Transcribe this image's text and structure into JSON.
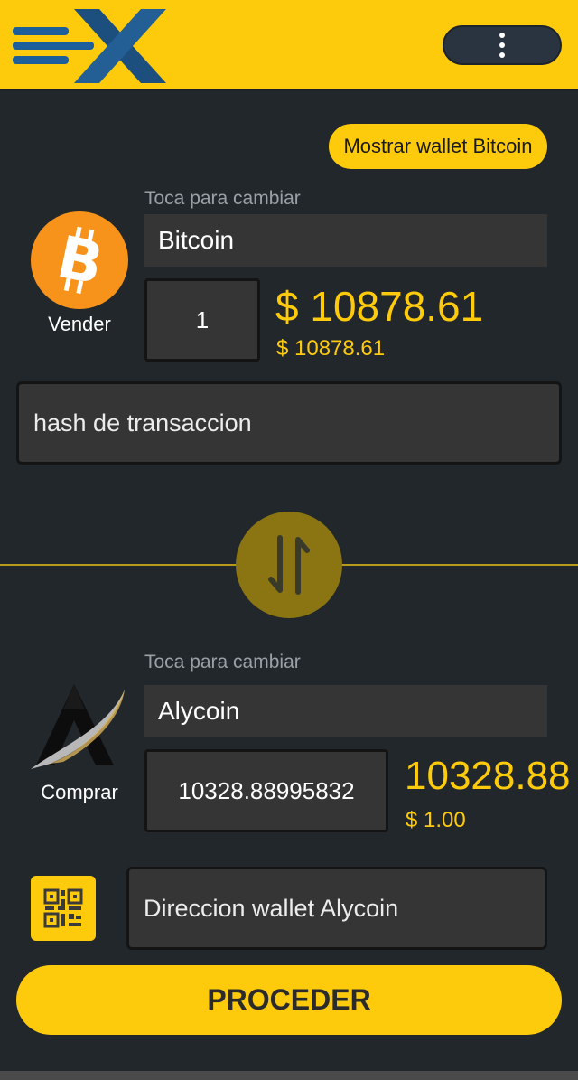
{
  "header": {
    "logo_icon": "ex-logo",
    "menu_icon": "more-vertical-icon"
  },
  "wallet_button": {
    "label": "Mostrar wallet Bitcoin"
  },
  "sell": {
    "hint": "Toca para cambiar",
    "coin_name": "Bitcoin",
    "coin_icon": "bitcoin-icon",
    "caption": "Vender",
    "amount": "1",
    "price_main": "$ 10878.61",
    "price_unit": "$ 10878.61",
    "hash_placeholder": "hash de transaccion"
  },
  "swap": {
    "icon": "swap-vertical-icon"
  },
  "buy": {
    "hint": "Toca para cambiar",
    "coin_name": "Alycoin",
    "coin_icon": "alycoin-logo",
    "caption": "Comprar",
    "amount": "10328.88995832",
    "price_main": "10328.88",
    "price_unit": "$ 1.00",
    "qr_icon": "qr-code-icon",
    "wallet_placeholder": "Direccion wallet Alycoin"
  },
  "proceed": {
    "label": "PROCEDER"
  },
  "colors": {
    "accent": "#fecb0c",
    "background": "#22272b",
    "field": "#353535",
    "bitcoin_orange": "#f7931a"
  }
}
